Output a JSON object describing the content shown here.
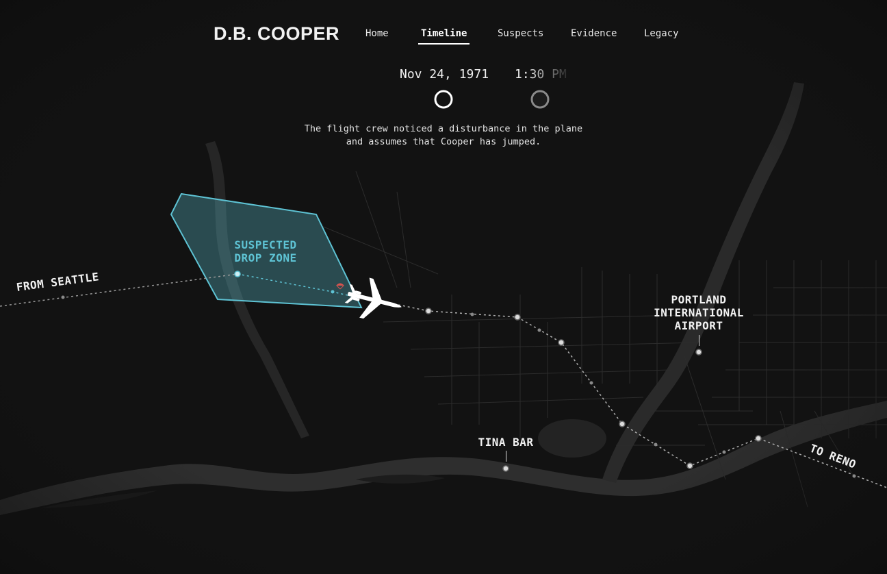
{
  "app": {
    "title": "D.B. COOPER"
  },
  "nav": {
    "items": [
      {
        "label": "Home",
        "active": false
      },
      {
        "label": "Timeline",
        "active": true
      },
      {
        "label": "Suspects",
        "active": false
      },
      {
        "label": "Evidence",
        "active": false
      },
      {
        "label": "Legacy",
        "active": false
      }
    ]
  },
  "timeline": {
    "date": "Nov 24, 1971",
    "time": "1:30 PM",
    "description_line1": "The flight crew noticed a disturbance in the plane",
    "description_line2": "and assumes that Cooper has jumped."
  },
  "map": {
    "zone_label_line1": "SUSPECTED",
    "zone_label_line2": "DROP ZONE",
    "from_label": "FROM SEATTLE",
    "to_label": "TO RENO",
    "airport_line1": "PORTLAND",
    "airport_line2": "INTERNATIONAL",
    "airport_line3": "AIRPORT",
    "tina_bar": "TINA BAR"
  },
  "colors": {
    "background": "#121212",
    "zone_accent": "#5ec3d4",
    "route": "#b0b0b0",
    "parachute": "#d9534f"
  },
  "icons": {
    "plane": "airplane-icon",
    "parachute": "parachute-icon"
  }
}
